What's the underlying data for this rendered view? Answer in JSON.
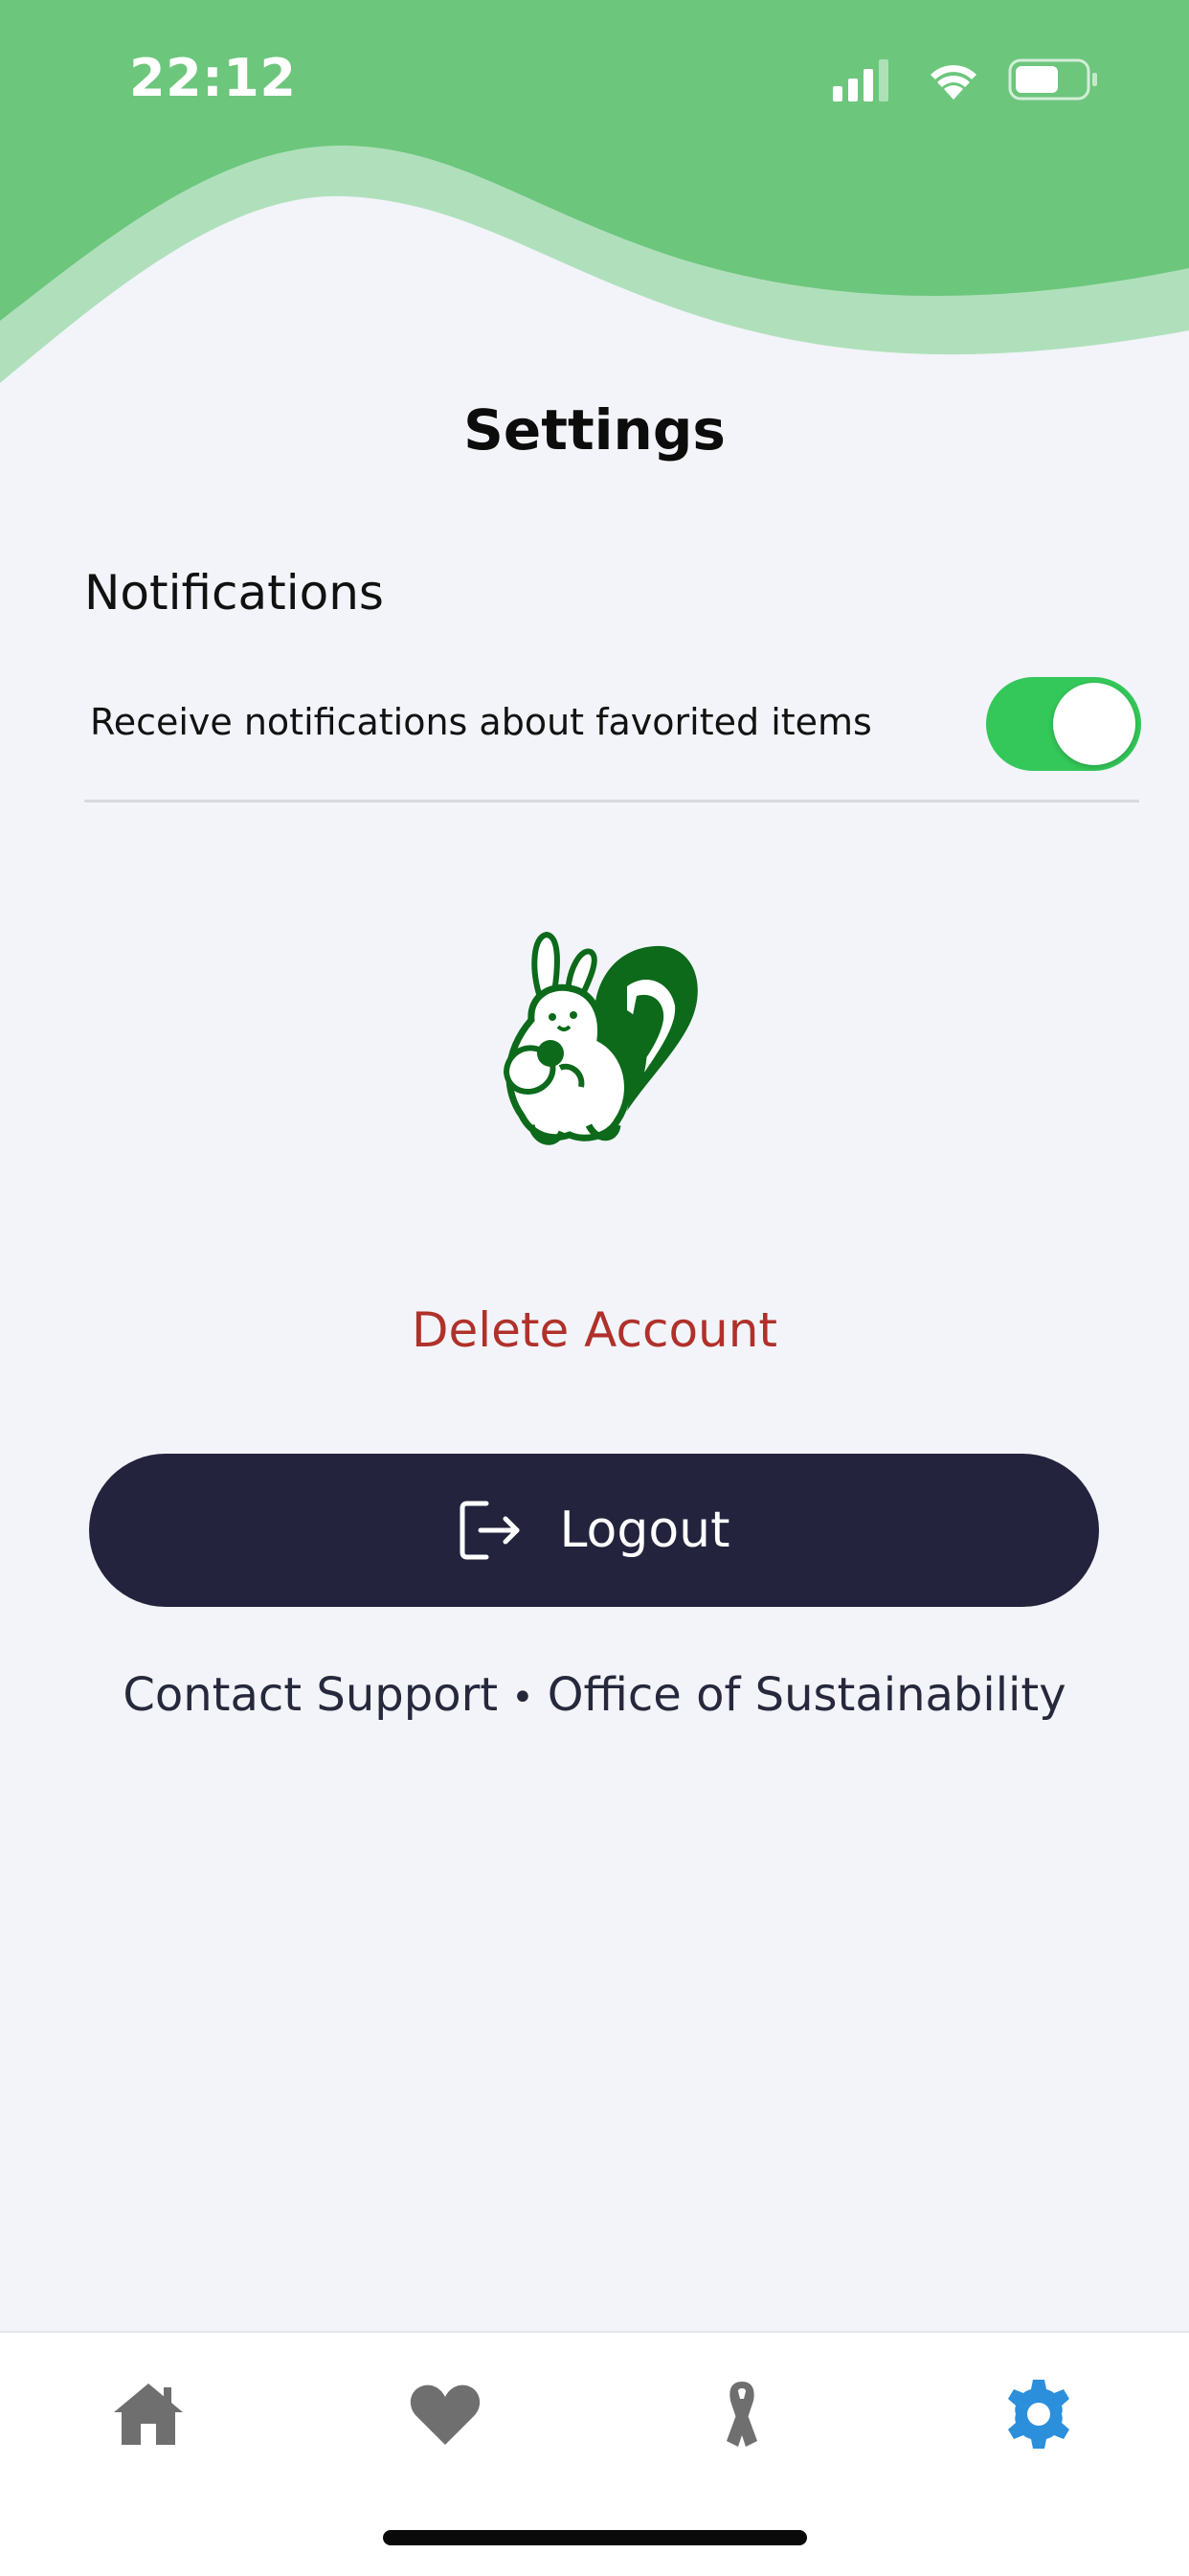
{
  "status_bar": {
    "time": "22:12"
  },
  "header": {
    "title": "Settings"
  },
  "notifications": {
    "section_title": "Notifications",
    "toggle_label": "Receive notifications about favorited items",
    "toggle_on": true
  },
  "mascot": {
    "icon": "squirrel-icon"
  },
  "account": {
    "delete_label": "Delete Account",
    "logout_label": "Logout"
  },
  "footer": {
    "contact_label": "Contact Support",
    "separator": "•",
    "office_label": "Office of Sustainability"
  },
  "tab_bar": {
    "tabs": [
      {
        "icon": "home-icon",
        "active": false
      },
      {
        "icon": "heart-icon",
        "active": false
      },
      {
        "icon": "ribbon-icon",
        "active": false
      },
      {
        "icon": "gear-icon",
        "active": true
      }
    ]
  },
  "colors": {
    "header_green": "#6cc67c",
    "header_light_green": "#b0e0bb",
    "background": "#f2f4f9",
    "toggle_on": "#34c759",
    "delete_red": "#b0312a",
    "logout_bg": "#23233d",
    "tab_inactive": "#6f6f6f",
    "tab_active": "#2b8fdc",
    "mascot_green": "#0c6a1a"
  }
}
